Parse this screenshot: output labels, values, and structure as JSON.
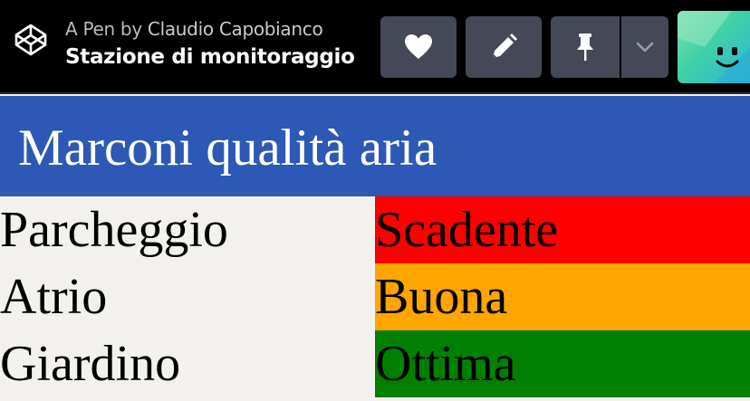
{
  "header": {
    "byline_prefix": "A Pen by",
    "author": "Claudio Capobianco",
    "pen_title": "Stazione di monitoraggio",
    "icons": {
      "logo": "codepen-logo-icon",
      "heart": "heart-icon",
      "edit": "pencil-icon",
      "pin": "pin-icon",
      "dropdown": "chevron-down-icon",
      "avatar": "smiley-avatar"
    }
  },
  "page": {
    "title": "Marconi qualità aria",
    "title_bg": "#2d58b5",
    "stations": [
      {
        "name": "Parcheggio",
        "status": "Scadente",
        "status_color": "#ff0000"
      },
      {
        "name": "Atrio",
        "status": "Buona",
        "status_color": "#ffa500"
      },
      {
        "name": "Giardino",
        "status": "Ottima",
        "status_color": "#008000"
      }
    ]
  }
}
